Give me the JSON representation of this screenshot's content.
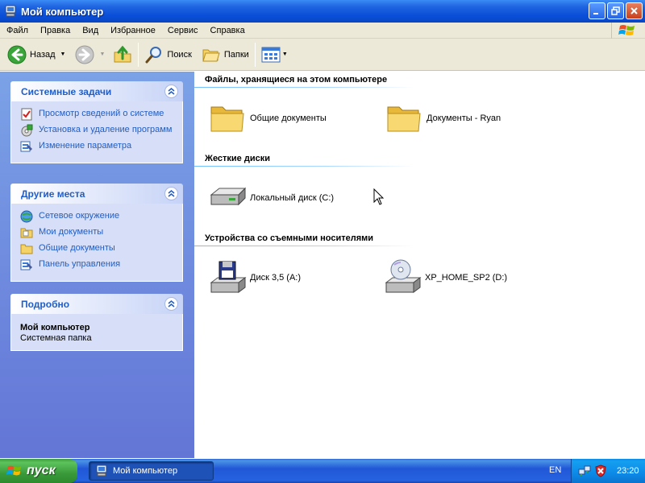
{
  "window": {
    "title": "Мой компьютер"
  },
  "menubar": {
    "items": [
      "Файл",
      "Правка",
      "Вид",
      "Избранное",
      "Сервис",
      "Справка"
    ]
  },
  "toolbar": {
    "back_label": "Назад",
    "search_label": "Поиск",
    "folders_label": "Папки"
  },
  "left_pane": {
    "system_tasks": {
      "title": "Системные задачи",
      "items": [
        {
          "label": "Просмотр сведений о системе",
          "icon": "system-info-icon"
        },
        {
          "label": "Установка и удаление программ",
          "icon": "add-remove-programs-icon"
        },
        {
          "label": "Изменение параметра",
          "icon": "control-panel-icon"
        }
      ]
    },
    "other_places": {
      "title": "Другие места",
      "items": [
        {
          "label": "Сетевое окружение",
          "icon": "network-icon"
        },
        {
          "label": "Мои документы",
          "icon": "folder-icon"
        },
        {
          "label": "Общие документы",
          "icon": "folder-icon"
        },
        {
          "label": "Панель управления",
          "icon": "control-panel-icon"
        }
      ]
    },
    "details": {
      "title": "Подробно",
      "name": "Мой компьютер",
      "type": "Системная папка"
    }
  },
  "content": {
    "groups": [
      {
        "title": "Файлы, хранящиеся на этом компьютере",
        "items": [
          {
            "label": "Общие документы",
            "icon": "folder-icon"
          },
          {
            "label": "Документы - Ryan",
            "icon": "folder-icon"
          }
        ]
      },
      {
        "title": "Жесткие диски",
        "items": [
          {
            "label": "Локальный диск (C:)",
            "icon": "hard-drive-icon"
          }
        ]
      },
      {
        "title": "Устройства со съемными носителями",
        "items": [
          {
            "label": "Диск 3,5 (A:)",
            "icon": "floppy-drive-icon"
          },
          {
            "label": "XP_HOME_SP2 (D:)",
            "icon": "cd-drive-icon"
          }
        ]
      }
    ]
  },
  "taskbar": {
    "start_label": "пуск",
    "active_window": "Мой компьютер",
    "language": "EN",
    "clock": "23:20"
  },
  "colors": {
    "title_bar": "#0a4ed8",
    "left_pane": "#6f8fde",
    "task_link": "#215dc6",
    "start_button": "#3a9a3a"
  }
}
